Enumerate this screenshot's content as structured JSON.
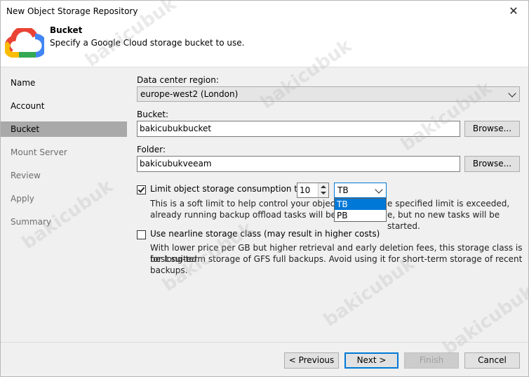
{
  "window": {
    "title": "New Object Storage Repository",
    "close_glyph": "✕"
  },
  "header": {
    "title": "Bucket",
    "subtitle": "Specify a Google Cloud storage bucket to use.",
    "logo_icon": "google-cloud-icon"
  },
  "sidebar": {
    "items": [
      {
        "label": "Name",
        "state": "normal"
      },
      {
        "label": "Account",
        "state": "normal"
      },
      {
        "label": "Bucket",
        "state": "active"
      },
      {
        "label": "Mount Server",
        "state": "disabled"
      },
      {
        "label": "Review",
        "state": "disabled"
      },
      {
        "label": "Apply",
        "state": "disabled"
      },
      {
        "label": "Summary",
        "state": "disabled"
      }
    ]
  },
  "region": {
    "label": "Data center region:",
    "value": "europe-west2 (London)"
  },
  "bucket": {
    "label": "Bucket:",
    "value": "bakicubukbucket",
    "browse": "Browse..."
  },
  "folder": {
    "label": "Folder:",
    "value": "bakicubukveeam",
    "browse": "Browse..."
  },
  "limit": {
    "checked": true,
    "label": "Limit object storage consumption to:",
    "value": "10",
    "unit": "TB",
    "options": [
      "TB",
      "PB"
    ],
    "desc_line1": "This is a soft limit to help control your object stora",
    "desc_line1b": "e specified limit is exceeded,",
    "desc_line2": "already running backup offload tasks will be allow",
    "desc_line2b": "e, but no new tasks will be started."
  },
  "nearline": {
    "checked": false,
    "label": "Use nearline storage class (may result in higher costs)",
    "desc_line1": "With lower price per GB but higher retrieval and early deletion fees, this storage class is best suited",
    "desc_line2": "for long-term storage of GFS full backups. Avoid using it for short-term storage of recent backups."
  },
  "footer": {
    "previous": "< Previous",
    "next": "Next >",
    "finish": "Finish",
    "cancel": "Cancel"
  },
  "watermark": "bakicubuk"
}
